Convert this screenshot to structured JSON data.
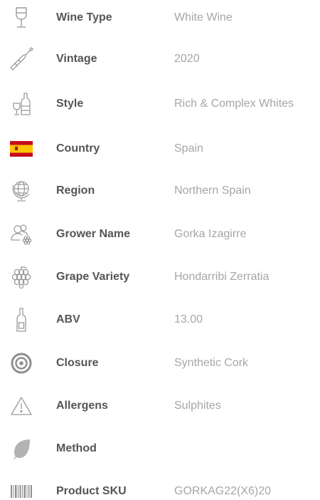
{
  "colors": {
    "label": "#555555",
    "value": "#a6a6a6",
    "icon": "#9a9a9a"
  },
  "specs": [
    {
      "icon": "wine-glass-icon",
      "label": "Wine Type",
      "value": "White Wine"
    },
    {
      "icon": "wine-bottle-icon",
      "label": "Vintage",
      "value": "2020"
    },
    {
      "icon": "glass-and-bottle-icon",
      "label": "Style",
      "value": "Rich & Complex Whites"
    },
    {
      "icon": "spain-flag-icon",
      "label": "Country",
      "value": "Spain"
    },
    {
      "icon": "globe-icon",
      "label": "Region",
      "value": "Northern Spain"
    },
    {
      "icon": "grower-people-icon",
      "label": "Grower Name",
      "value": "Gorka Izagirre"
    },
    {
      "icon": "grape-cluster-icon",
      "label": "Grape Variety",
      "value": "Hondarribi Zerratia"
    },
    {
      "icon": "abv-bottle-icon",
      "label": "ABV",
      "value": "13.00"
    },
    {
      "icon": "closure-target-icon",
      "label": "Closure",
      "value": "Synthetic Cork"
    },
    {
      "icon": "warning-triangle-icon",
      "label": "Allergens",
      "value": "Sulphites"
    },
    {
      "icon": "leaf-icon",
      "label": "Method",
      "value": ""
    },
    {
      "icon": "barcode-icon",
      "label": "Product SKU",
      "value": "GORKAG22(X6)20"
    }
  ]
}
